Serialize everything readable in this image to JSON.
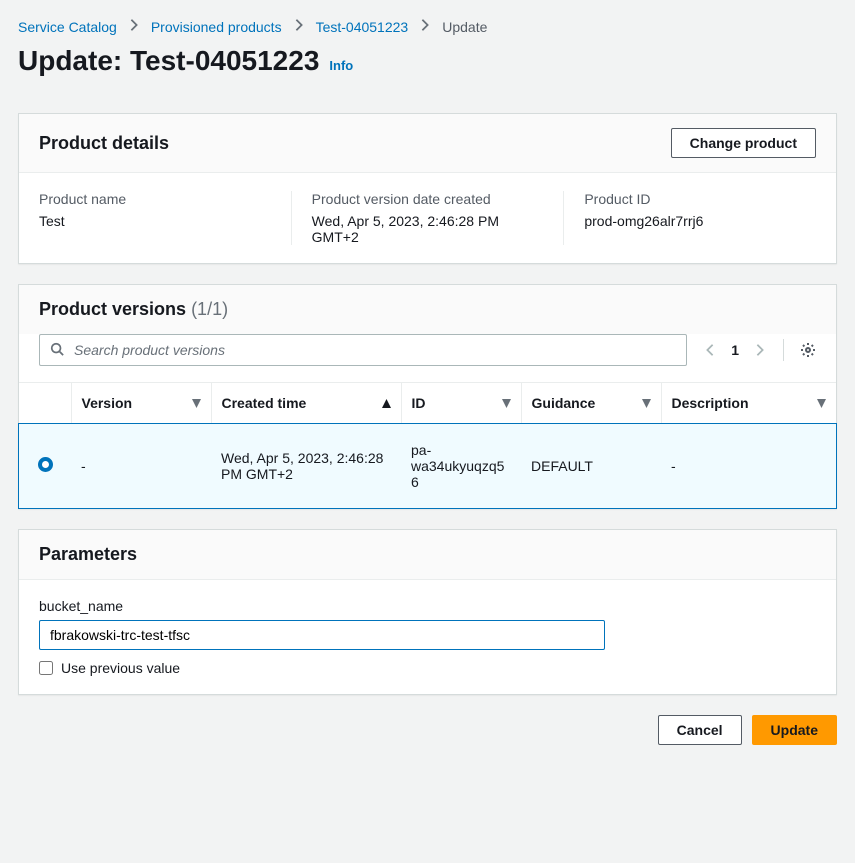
{
  "breadcrumb": {
    "service_catalog": "Service Catalog",
    "provisioned_products": "Provisioned products",
    "product_name": "Test-04051223",
    "current": "Update"
  },
  "page": {
    "title": "Update: Test-04051223",
    "info": "Info"
  },
  "product_details": {
    "title": "Product details",
    "change_product_btn": "Change product",
    "name_label": "Product name",
    "name_value": "Test",
    "date_label": "Product version date created",
    "date_value": "Wed, Apr 5, 2023, 2:46:28 PM GMT+2",
    "id_label": "Product ID",
    "id_value": "prod-omg26alr7rrj6"
  },
  "product_versions": {
    "title": "Product versions",
    "count": "(1/1)",
    "search_placeholder": "Search product versions",
    "page_num": "1",
    "cols": {
      "version": "Version",
      "created": "Created time",
      "id": "ID",
      "guidance": "Guidance",
      "description": "Description"
    },
    "rows": [
      {
        "selected": true,
        "version": "-",
        "created": "Wed, Apr 5, 2023, 2:46:28 PM GMT+2",
        "id": "pa-wa34ukyuqzq56",
        "guidance": "DEFAULT",
        "description": "-"
      }
    ]
  },
  "parameters": {
    "title": "Parameters",
    "bucket_name_label": "bucket_name",
    "bucket_name_value": "fbrakowski-trc-test-tfsc",
    "use_previous": "Use previous value"
  },
  "footer": {
    "cancel": "Cancel",
    "update": "Update"
  }
}
